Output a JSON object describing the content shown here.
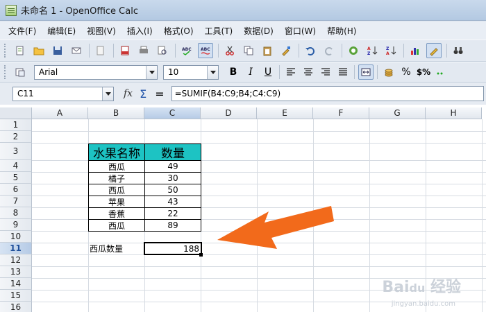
{
  "window": {
    "title": "未命名 1 - OpenOffice Calc"
  },
  "menu": [
    "文件(F)",
    "编辑(E)",
    "视图(V)",
    "插入(I)",
    "格式(O)",
    "工具(T)",
    "数据(D)",
    "窗口(W)",
    "帮助(H)"
  ],
  "toolbar2": {
    "font_name": "Arial",
    "font_size": "10",
    "bold": "B",
    "italic": "I",
    "underline": "U",
    "currency": "%",
    "percent_format": "$%"
  },
  "formula_bar": {
    "cell_ref": "C11",
    "fx": "fx",
    "sigma": "Σ",
    "equals": "=",
    "formula": "=SUMIF(B4:C9;B4;C4:C9)"
  },
  "sheet": {
    "columns": [
      "A",
      "B",
      "C",
      "D",
      "E",
      "F",
      "G",
      "H"
    ],
    "selected_column": "C",
    "rows": [
      "1",
      "2",
      "3",
      "4",
      "5",
      "6",
      "7",
      "8",
      "9",
      "10",
      "11",
      "12",
      "13",
      "14",
      "15",
      "16"
    ],
    "selected_row": "11",
    "table": {
      "headers": [
        "水果名称",
        "数量"
      ],
      "header_color": "#1dc3c3",
      "rows": [
        [
          "西瓜",
          "49"
        ],
        [
          "橘子",
          "30"
        ],
        [
          "西瓜",
          "50"
        ],
        [
          "苹果",
          "43"
        ],
        [
          "香蕉",
          "22"
        ],
        [
          "西瓜",
          "89"
        ]
      ]
    },
    "result_label": "西瓜数量",
    "result_value": "188"
  },
  "annotation": {
    "arrow_color": "#f26a1b"
  }
}
